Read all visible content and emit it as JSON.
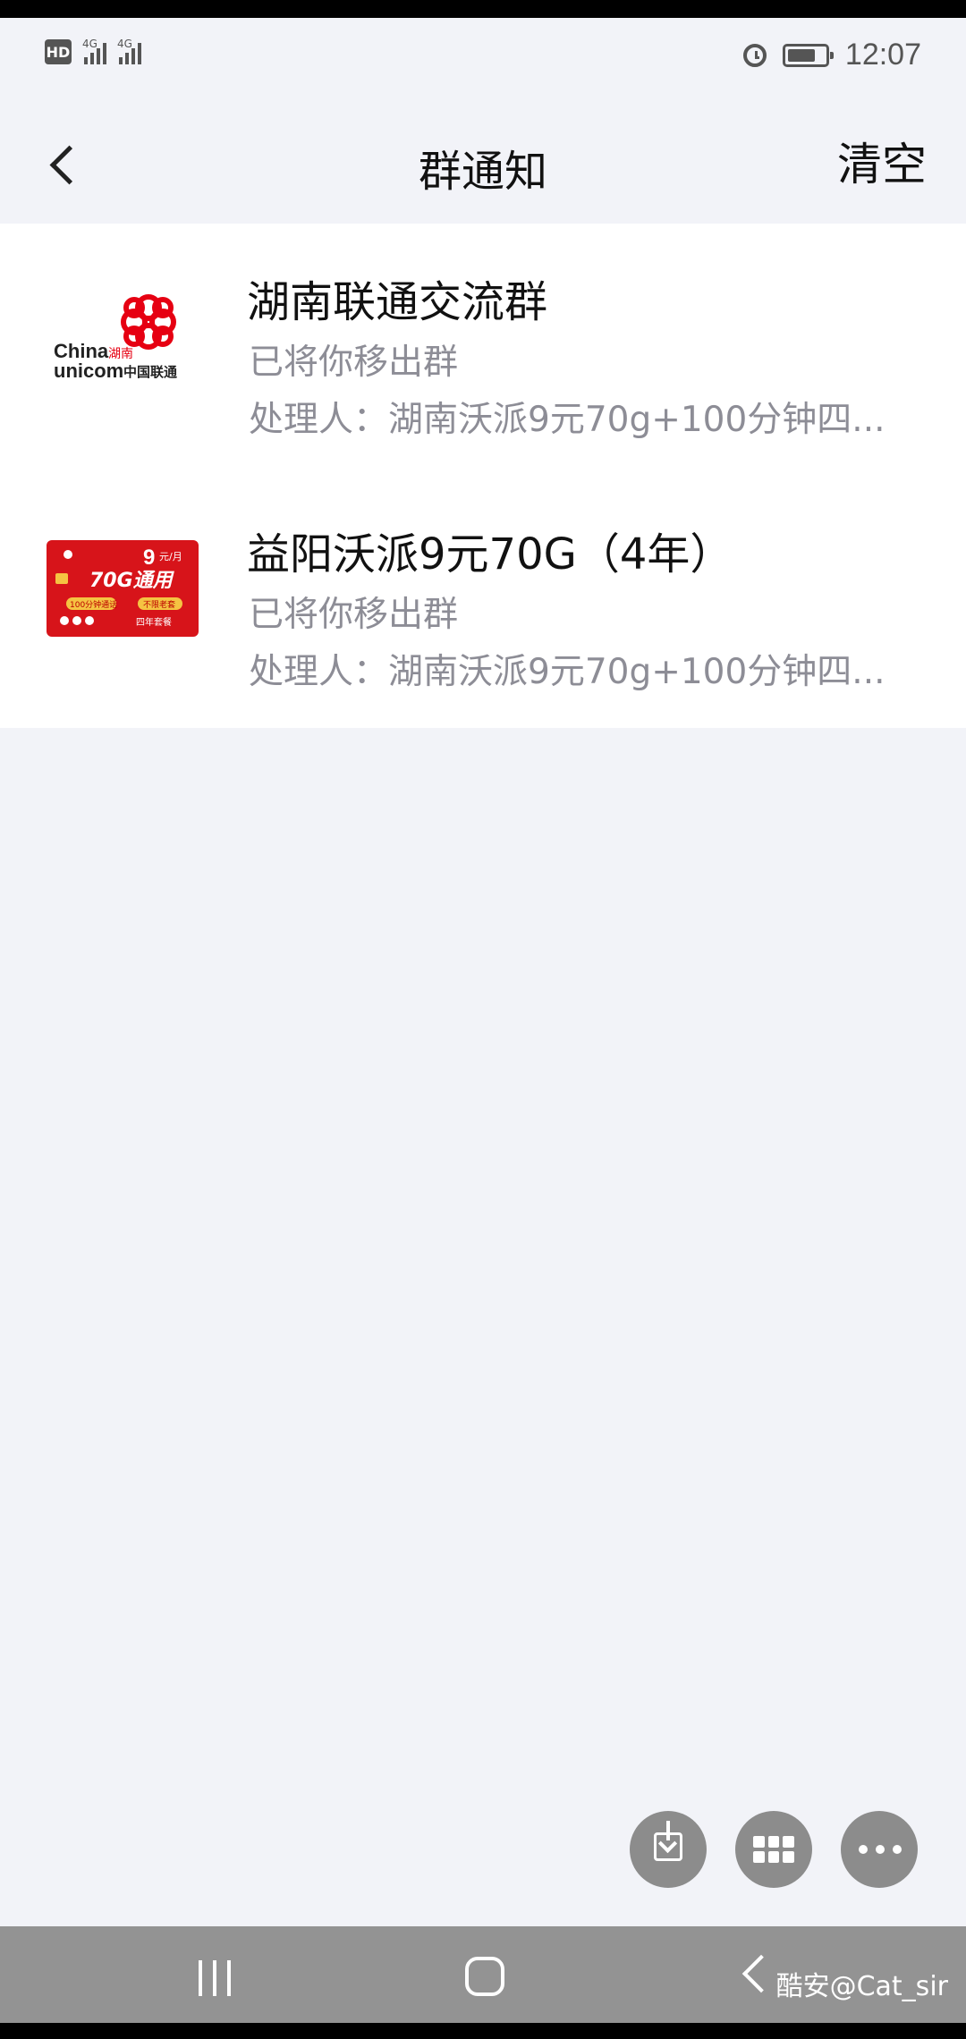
{
  "status_bar": {
    "hd": "HD",
    "sim1_net": "4G",
    "sim2_net": "4G",
    "time": "12:07",
    "battery_level": 0.75
  },
  "header": {
    "title": "群通知",
    "clear_label": "清空"
  },
  "notifications": [
    {
      "group_name": "湖南联通交流群",
      "status": "已将你移出群",
      "handler": "处理人：湖南沃派9元70g+100分钟四...",
      "avatar": {
        "kind": "logo",
        "brand_en_1": "China",
        "brand_en_2": "unicom",
        "region": "湖南",
        "brand_cn": "中国联通",
        "color": "#e60012"
      }
    },
    {
      "group_name": "益阳沃派9元70G（4年）",
      "status": "已将你移出群",
      "handler": "处理人：湖南沃派9元70g+100分钟四...",
      "avatar": {
        "kind": "card",
        "price": "9",
        "price_unit": "元/月",
        "data": "70G通用",
        "minutes": "100分钟通话",
        "badge": "不限老套",
        "term": "四年套餐",
        "color": "#d7141a"
      }
    }
  ],
  "fab": {
    "download_icon": "download-icon",
    "grid_icon": "grid-icon",
    "more_icon": "more-icon"
  },
  "system_nav": {
    "watermark": "酷安@Cat_sir"
  }
}
